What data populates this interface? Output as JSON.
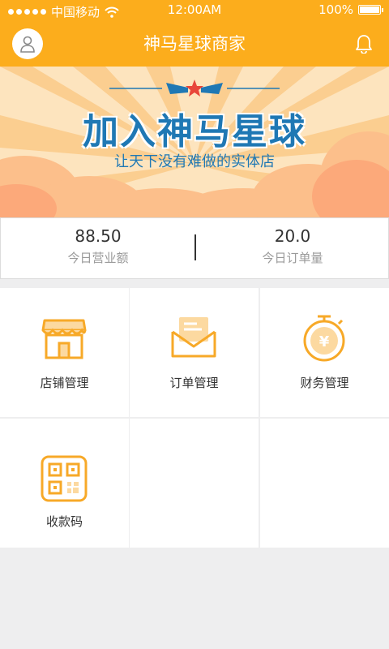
{
  "status_bar": {
    "carrier": "中国移动",
    "time": "12:00AM",
    "battery": "100%",
    "battery_level": 1.0
  },
  "header": {
    "title": "神马星球商家"
  },
  "banner": {
    "headline": "加入神马星球",
    "subline": "让天下没有难做的实体店"
  },
  "stats": {
    "revenue_value": "88.50",
    "revenue_label": "今日营业额",
    "orders_value": "20.0",
    "orders_label": "今日订单量"
  },
  "menu": {
    "items": [
      {
        "label": "店铺管理",
        "icon": "shop-icon"
      },
      {
        "label": "订单管理",
        "icon": "order-envelope-icon"
      },
      {
        "label": "财务管理",
        "icon": "finance-yuan-icon"
      },
      {
        "label": "收款码",
        "icon": "qr-code-icon"
      }
    ]
  },
  "colors": {
    "brand": "#fcad1c",
    "banner_text": "#1f78b4",
    "background": "#eeeeef"
  }
}
